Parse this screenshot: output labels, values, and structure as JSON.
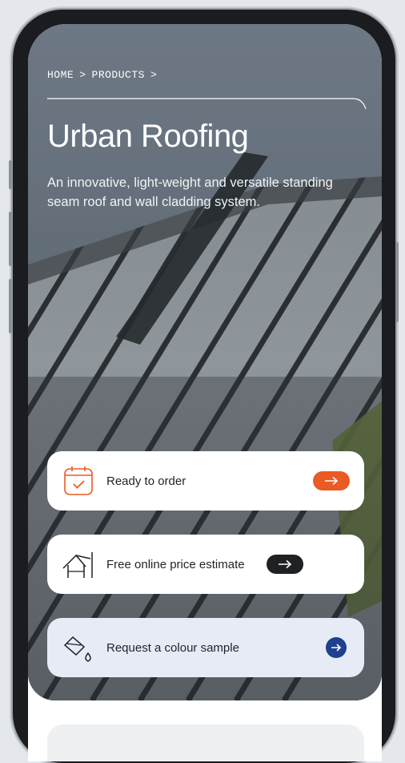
{
  "breadcrumb": {
    "home": "HOME",
    "products": "PRODUCTS",
    "separator": ">"
  },
  "hero": {
    "title": "Urban Roofing",
    "description": "An innovative, light-weight and versatile standing seam roof and wall cladding system."
  },
  "actions": [
    {
      "label": "Ready to order",
      "icon": "calendar-check-icon",
      "button": "arrow-right-icon",
      "color": "#ea5a24"
    },
    {
      "label": "Free online price estimate",
      "icon": "house-roof-icon",
      "button": "arrow-right-icon",
      "color": "#1f2124"
    },
    {
      "label": "Request a colour sample",
      "icon": "paint-swatch-icon",
      "button": "arrow-right-icon",
      "color": "#1f3f8f"
    }
  ],
  "colors": {
    "accent_orange": "#ea5a24",
    "dark": "#1f2124",
    "navy": "#1f3f8f",
    "sample_card_bg": "#e7ebf5"
  }
}
